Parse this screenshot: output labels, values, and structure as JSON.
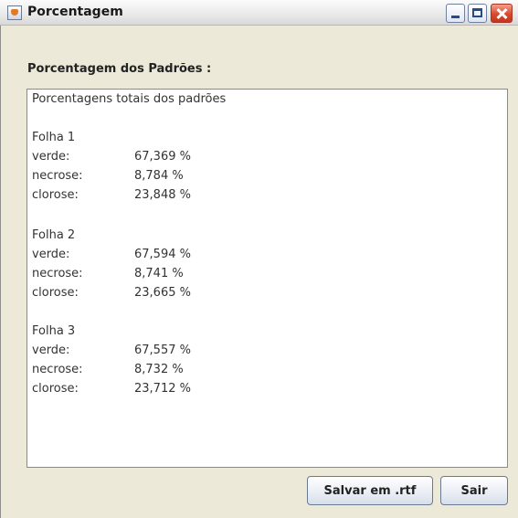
{
  "window": {
    "title": "Porcentagem"
  },
  "section_label": "Porcentagem dos Padrões :",
  "report": {
    "header": "Porcentagens totais dos padrões",
    "leaves": [
      {
        "title": "Folha 1",
        "rows": [
          {
            "label": "verde:",
            "value": "67,369 %"
          },
          {
            "label": "necrose:",
            "value": "8,784 %"
          },
          {
            "label": "clorose:",
            "value": "23,848 %"
          }
        ]
      },
      {
        "title": "Folha 2",
        "rows": [
          {
            "label": "verde:",
            "value": "67,594 %"
          },
          {
            "label": "necrose:",
            "value": "8,741 %"
          },
          {
            "label": "clorose:",
            "value": "23,665 %"
          }
        ]
      },
      {
        "title": "Folha 3",
        "rows": [
          {
            "label": "verde:",
            "value": "67,557 %"
          },
          {
            "label": "necrose:",
            "value": "8,732 %"
          },
          {
            "label": "clorose:",
            "value": "23,712 %"
          }
        ]
      }
    ]
  },
  "buttons": {
    "save_label": "Salvar em .rtf",
    "exit_label": "Sair"
  },
  "icons": {
    "app": "java-app-icon",
    "minimize": "minimize-icon",
    "maximize": "maximize-icon",
    "close": "close-icon"
  },
  "colors": {
    "window_bg": "#ece9d8",
    "text_area_bg": "#ffffff",
    "close_button": "#d84a2d"
  }
}
